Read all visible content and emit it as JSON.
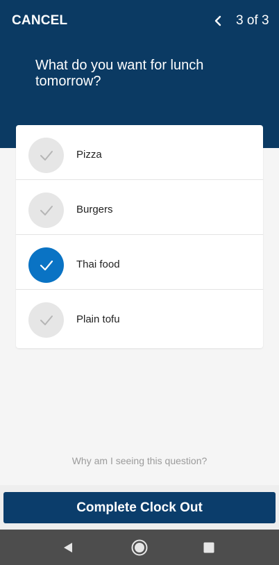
{
  "header": {
    "cancel_label": "CANCEL",
    "step_label": "3 of 3",
    "question": "What do you want for lunch tomorrow?"
  },
  "options": [
    {
      "label": "Pizza",
      "selected": false,
      "icon": "check-icon"
    },
    {
      "label": "Burgers",
      "selected": false,
      "icon": "check-icon"
    },
    {
      "label": "Thai food",
      "selected": true,
      "icon": "check-icon"
    },
    {
      "label": "Plain tofu",
      "selected": false,
      "icon": "check-icon"
    }
  ],
  "help_link": "Why am I seeing this question?",
  "primary_button": "Complete Clock Out",
  "nav_icons": [
    "back-triangle-icon",
    "home-circle-icon",
    "recents-square-icon"
  ],
  "colors": {
    "header_bg": "#0b3a63",
    "selected": "#0a73c4",
    "button_bg": "#0b3d6b"
  }
}
